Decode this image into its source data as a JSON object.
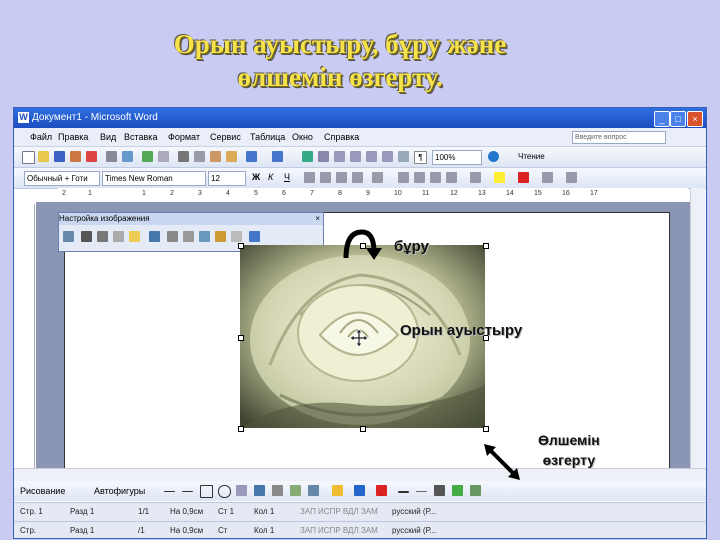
{
  "slide": {
    "title_line1": "Орын ауыстыру, бұру  және",
    "title_line2": "өлшемін өзгерту."
  },
  "window": {
    "title": "Документ1 - Microsoft Word",
    "minimize": "_",
    "maximize": "□",
    "close": "×"
  },
  "menu": {
    "items": [
      "Файл",
      "Правка",
      "Вид",
      "Вставка",
      "Формат",
      "Сервис",
      "Таблица",
      "Окно",
      "Справка"
    ],
    "question_placeholder": "Введите вопрос"
  },
  "toolbar": {
    "zoom": "100%",
    "reading": "Чтение"
  },
  "format": {
    "style": "Обычный + Готи",
    "font": "Times New Roman",
    "size": "12"
  },
  "ruler": {
    "marks": [
      "2",
      "1",
      "1",
      "2",
      "3",
      "4",
      "5",
      "6",
      "7",
      "8",
      "9",
      "10",
      "11",
      "12",
      "13",
      "14",
      "15",
      "16",
      "17"
    ]
  },
  "picture_toolbar": {
    "title": "Настройка изображения"
  },
  "labels": {
    "rotate": "бұру",
    "move": "Орын ауыстыру",
    "resize_line1": "Өлшемін",
    "resize_line2": "өзгерту"
  },
  "drawing": {
    "draw": "Рисование",
    "autoshapes": "Автофигуры"
  },
  "status_top": {
    "page": "Стр. 1",
    "section": "Разд 1",
    "pages": "1/1",
    "at": "На 0,9см",
    "line": "Ст 1",
    "col": "Кол 1",
    "modes": "ЗАП  ИСПР  ВДЛ  ЗАМ",
    "lang": "русский (Р..."
  },
  "status_bottom": {
    "page": "Стр.",
    "section": "Разд 1",
    "pages": "/1",
    "at": "На 0,9см",
    "line": "Ст",
    "col": "Кол 1",
    "modes": "ЗАП  ИСПР  ВДЛ  ЗАМ",
    "lang": "русский (Р..."
  }
}
